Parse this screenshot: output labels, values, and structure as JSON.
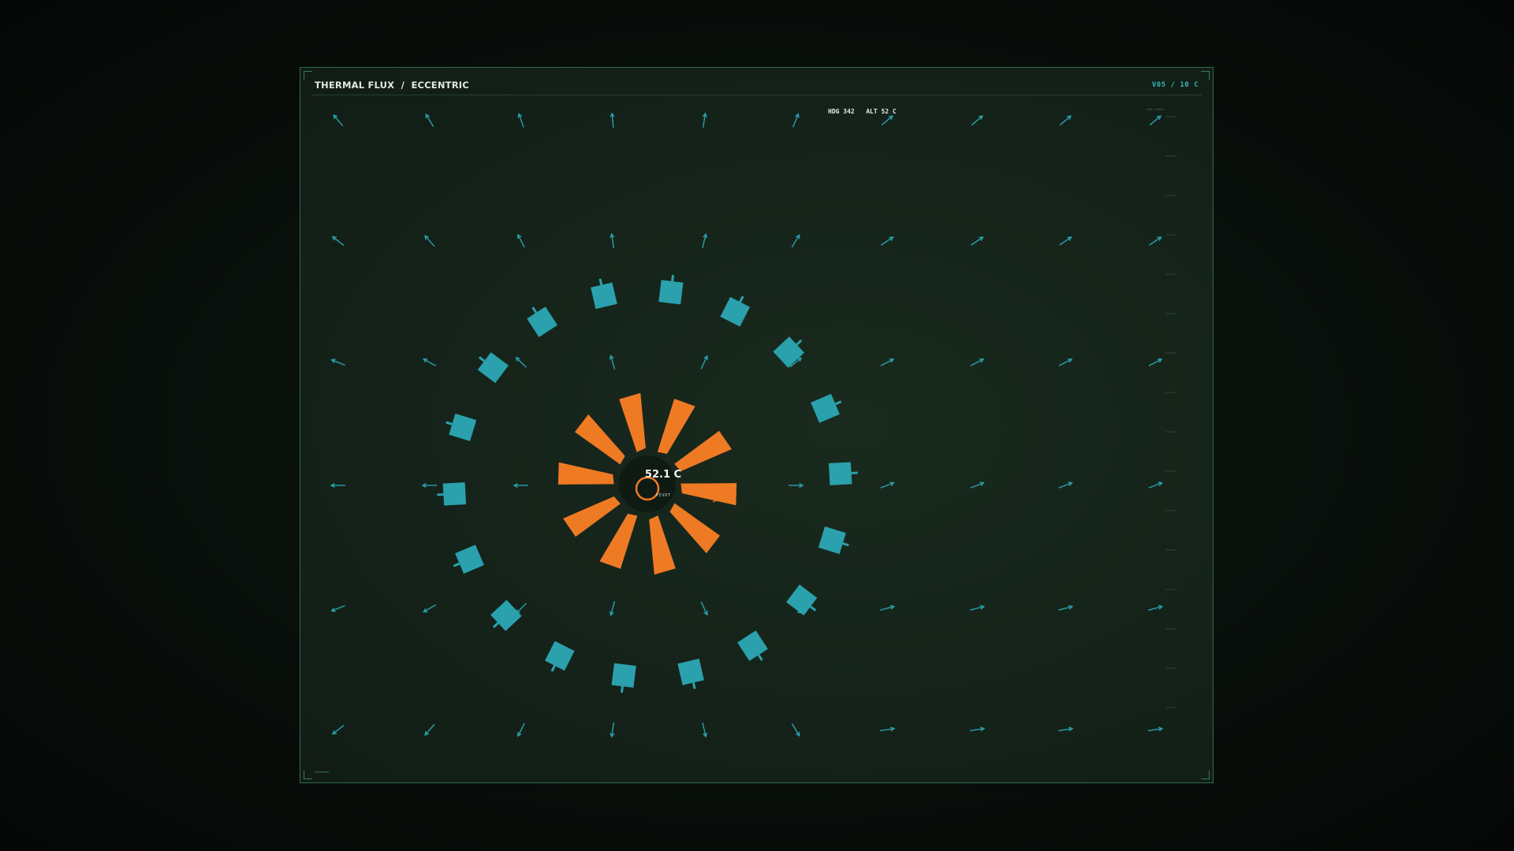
{
  "header": {
    "title": "THERMAL FLUX  /  ECCENTRIC",
    "badge": "V05 / 10  C"
  },
  "hud": {
    "heading_label": "HDG",
    "heading_value": "342",
    "altitude_label": "ALT",
    "altitude_value": "52 C"
  },
  "center": {
    "readout": "52.1 C",
    "sub_label": "PIVOT"
  },
  "colors": {
    "accent_teal": "#2aa1ad",
    "accent_orange": "#ef7a24",
    "frame_green": "#2f6b50"
  },
  "icons": {
    "field_vector": "arrow-icon",
    "outer_marker": "tabbed-square-icon",
    "inner_ray": "flare-icon",
    "pivot": "ring-icon"
  }
}
